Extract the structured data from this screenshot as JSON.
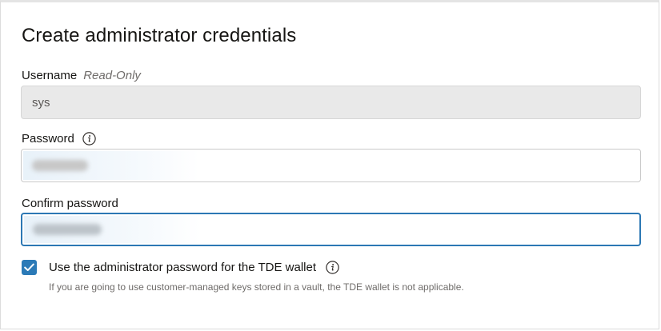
{
  "form": {
    "title": "Create administrator credentials",
    "username": {
      "label": "Username",
      "note": "Read-Only",
      "value": "sys"
    },
    "password": {
      "label": "Password",
      "info_icon": "info-icon"
    },
    "confirm_password": {
      "label": "Confirm password"
    },
    "tde_checkbox": {
      "checked": true,
      "label": "Use the administrator password for the TDE wallet",
      "info_icon": "info-icon",
      "helper": "If you are going to use customer-managed keys stored in a vault, the TDE wallet is not applicable."
    }
  },
  "colors": {
    "accent": "#2c78b4",
    "readonly_bg": "#e9e9e9"
  }
}
